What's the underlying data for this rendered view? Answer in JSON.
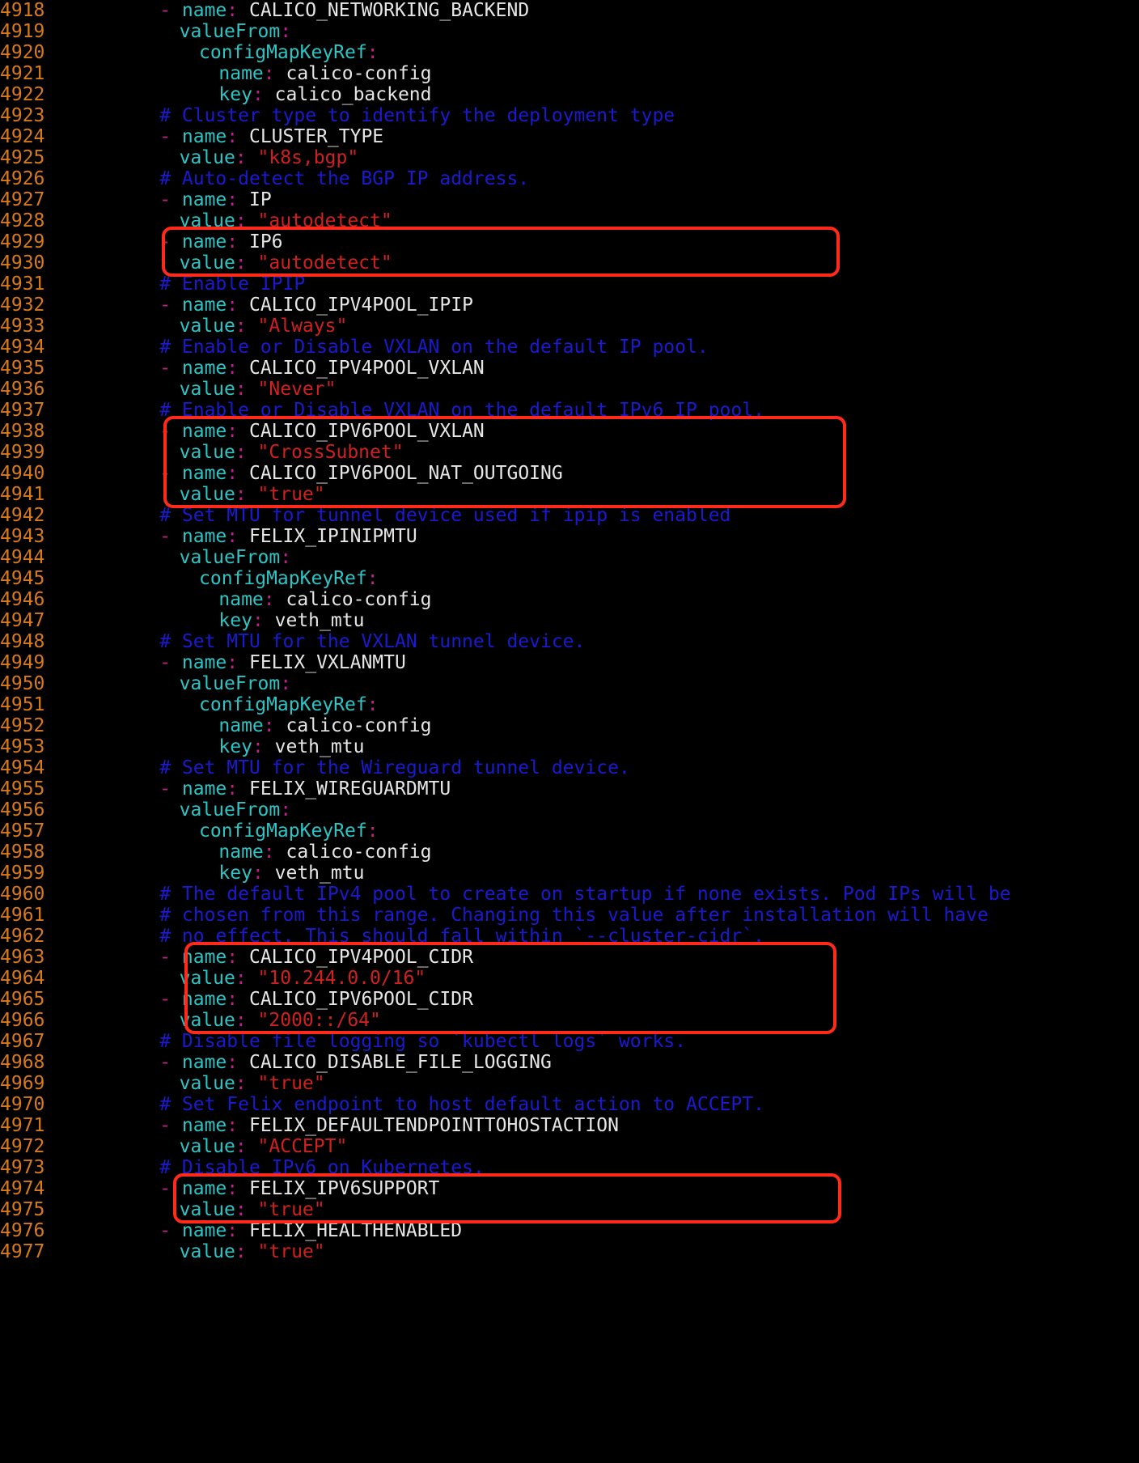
{
  "editor": {
    "lines": [
      {
        "n": "4918",
        "kind": "item",
        "indent": 8,
        "key": "name",
        "value": "CALICO_NETWORKING_BACKEND"
      },
      {
        "n": "4919",
        "kind": "mapkey",
        "indent": 9,
        "key": "valueFrom"
      },
      {
        "n": "4920",
        "kind": "mapkey",
        "indent": 10,
        "key": "configMapKeyRef"
      },
      {
        "n": "4921",
        "kind": "kv",
        "indent": 11,
        "key": "name",
        "value": "calico-config"
      },
      {
        "n": "4922",
        "kind": "kv",
        "indent": 11,
        "key": "key",
        "value": "calico_backend"
      },
      {
        "n": "4923",
        "kind": "comment",
        "indent": 8,
        "text": "# Cluster type to identify the deployment type"
      },
      {
        "n": "4924",
        "kind": "item",
        "indent": 8,
        "key": "name",
        "value": "CLUSTER_TYPE"
      },
      {
        "n": "4925",
        "kind": "kvstr",
        "indent": 9,
        "key": "value",
        "value": "\"k8s,bgp\""
      },
      {
        "n": "4926",
        "kind": "comment",
        "indent": 8,
        "text": "# Auto-detect the BGP IP address."
      },
      {
        "n": "4927",
        "kind": "item",
        "indent": 8,
        "key": "name",
        "value": "IP"
      },
      {
        "n": "4928",
        "kind": "kvstr",
        "indent": 9,
        "key": "value",
        "value": "\"autodetect\""
      },
      {
        "n": "4929",
        "kind": "item",
        "indent": 8,
        "key": "name",
        "value": "IP6"
      },
      {
        "n": "4930",
        "kind": "kvstr",
        "indent": 9,
        "key": "value",
        "value": "\"autodetect\""
      },
      {
        "n": "4931",
        "kind": "comment",
        "indent": 8,
        "text": "# Enable IPIP"
      },
      {
        "n": "4932",
        "kind": "item",
        "indent": 8,
        "key": "name",
        "value": "CALICO_IPV4POOL_IPIP"
      },
      {
        "n": "4933",
        "kind": "kvstr",
        "indent": 9,
        "key": "value",
        "value": "\"Always\""
      },
      {
        "n": "4934",
        "kind": "comment",
        "indent": 8,
        "text": "# Enable or Disable VXLAN on the default IP pool."
      },
      {
        "n": "4935",
        "kind": "item",
        "indent": 8,
        "key": "name",
        "value": "CALICO_IPV4POOL_VXLAN"
      },
      {
        "n": "4936",
        "kind": "kvstr",
        "indent": 9,
        "key": "value",
        "value": "\"Never\""
      },
      {
        "n": "4937",
        "kind": "comment",
        "indent": 8,
        "text": "# Enable or Disable VXLAN on the default IPv6 IP pool."
      },
      {
        "n": "4938",
        "kind": "item",
        "indent": 8,
        "key": "name",
        "value": "CALICO_IPV6POOL_VXLAN"
      },
      {
        "n": "4939",
        "kind": "kvstr",
        "indent": 9,
        "key": "value",
        "value": "\"CrossSubnet\""
      },
      {
        "n": "4940",
        "kind": "item",
        "indent": 8,
        "key": "name",
        "value": "CALICO_IPV6POOL_NAT_OUTGOING"
      },
      {
        "n": "4941",
        "kind": "kvstr",
        "indent": 9,
        "key": "value",
        "value": "\"true\""
      },
      {
        "n": "4942",
        "kind": "comment",
        "indent": 8,
        "text": "# Set MTU for tunnel device used if ipip is enabled"
      },
      {
        "n": "4943",
        "kind": "item",
        "indent": 8,
        "key": "name",
        "value": "FELIX_IPINIPMTU"
      },
      {
        "n": "4944",
        "kind": "mapkey",
        "indent": 9,
        "key": "valueFrom"
      },
      {
        "n": "4945",
        "kind": "mapkey",
        "indent": 10,
        "key": "configMapKeyRef"
      },
      {
        "n": "4946",
        "kind": "kv",
        "indent": 11,
        "key": "name",
        "value": "calico-config"
      },
      {
        "n": "4947",
        "kind": "kv",
        "indent": 11,
        "key": "key",
        "value": "veth_mtu"
      },
      {
        "n": "4948",
        "kind": "comment",
        "indent": 8,
        "text": "# Set MTU for the VXLAN tunnel device."
      },
      {
        "n": "4949",
        "kind": "item",
        "indent": 8,
        "key": "name",
        "value": "FELIX_VXLANMTU"
      },
      {
        "n": "4950",
        "kind": "mapkey",
        "indent": 9,
        "key": "valueFrom"
      },
      {
        "n": "4951",
        "kind": "mapkey",
        "indent": 10,
        "key": "configMapKeyRef"
      },
      {
        "n": "4952",
        "kind": "kv",
        "indent": 11,
        "key": "name",
        "value": "calico-config"
      },
      {
        "n": "4953",
        "kind": "kv",
        "indent": 11,
        "key": "key",
        "value": "veth_mtu"
      },
      {
        "n": "4954",
        "kind": "comment",
        "indent": 8,
        "text": "# Set MTU for the Wireguard tunnel device."
      },
      {
        "n": "4955",
        "kind": "item",
        "indent": 8,
        "key": "name",
        "value": "FELIX_WIREGUARDMTU"
      },
      {
        "n": "4956",
        "kind": "mapkey",
        "indent": 9,
        "key": "valueFrom"
      },
      {
        "n": "4957",
        "kind": "mapkey",
        "indent": 10,
        "key": "configMapKeyRef"
      },
      {
        "n": "4958",
        "kind": "kv",
        "indent": 11,
        "key": "name",
        "value": "calico-config"
      },
      {
        "n": "4959",
        "kind": "kv",
        "indent": 11,
        "key": "key",
        "value": "veth_mtu"
      },
      {
        "n": "4960",
        "kind": "comment",
        "indent": 8,
        "text": "# The default IPv4 pool to create on startup if none exists. Pod IPs will be"
      },
      {
        "n": "4961",
        "kind": "comment",
        "indent": 8,
        "text": "# chosen from this range. Changing this value after installation will have"
      },
      {
        "n": "4962",
        "kind": "comment",
        "indent": 8,
        "text": "# no effect. This should fall within `--cluster-cidr`."
      },
      {
        "n": "4963",
        "kind": "item",
        "indent": 8,
        "key": "name",
        "value": "CALICO_IPV4POOL_CIDR"
      },
      {
        "n": "4964",
        "kind": "kvstr",
        "indent": 9,
        "key": "value",
        "value": "\"10.244.0.0/16\""
      },
      {
        "n": "4965",
        "kind": "item",
        "indent": 8,
        "key": "name",
        "value": "CALICO_IPV6POOL_CIDR"
      },
      {
        "n": "4966",
        "kind": "kvstr",
        "indent": 9,
        "key": "value",
        "value": "\"2000::/64\""
      },
      {
        "n": "4967",
        "kind": "comment",
        "indent": 8,
        "text": "# Disable file logging so `kubectl logs` works."
      },
      {
        "n": "4968",
        "kind": "item",
        "indent": 8,
        "key": "name",
        "value": "CALICO_DISABLE_FILE_LOGGING"
      },
      {
        "n": "4969",
        "kind": "kvstr",
        "indent": 9,
        "key": "value",
        "value": "\"true\""
      },
      {
        "n": "4970",
        "kind": "comment",
        "indent": 8,
        "text": "# Set Felix endpoint to host default action to ACCEPT."
      },
      {
        "n": "4971",
        "kind": "item",
        "indent": 8,
        "key": "name",
        "value": "FELIX_DEFAULTENDPOINTTOHOSTACTION"
      },
      {
        "n": "4972",
        "kind": "kvstr",
        "indent": 9,
        "key": "value",
        "value": "\"ACCEPT\""
      },
      {
        "n": "4973",
        "kind": "comment",
        "indent": 8,
        "text": "# Disable IPv6 on Kubernetes."
      },
      {
        "n": "4974",
        "kind": "item",
        "indent": 8,
        "key": "name",
        "value": "FELIX_IPV6SUPPORT"
      },
      {
        "n": "4975",
        "kind": "kvstr",
        "indent": 9,
        "key": "value",
        "value": "\"true\""
      },
      {
        "n": "4976",
        "kind": "item",
        "indent": 8,
        "key": "name",
        "value": "FELIX_HEALTHENABLED"
      },
      {
        "n": "4977",
        "kind": "kvstr",
        "indent": 9,
        "key": "value",
        "value": "\"true\""
      }
    ],
    "highlights": [
      {
        "first": "4929",
        "last": "4930"
      },
      {
        "first": "4938",
        "last": "4941"
      },
      {
        "first": "4963",
        "last": "4966"
      },
      {
        "first": "4974",
        "last": "4975"
      }
    ]
  },
  "colors": {
    "background": "#000000",
    "line_number": "#d97a1a",
    "key": "#2ec4c4",
    "punctuation": "#c0208a",
    "plain_value": "#e6e6e6",
    "string_value": "#d02020",
    "comment": "#1a1ad0",
    "highlight_box": "#ff2a1a"
  }
}
